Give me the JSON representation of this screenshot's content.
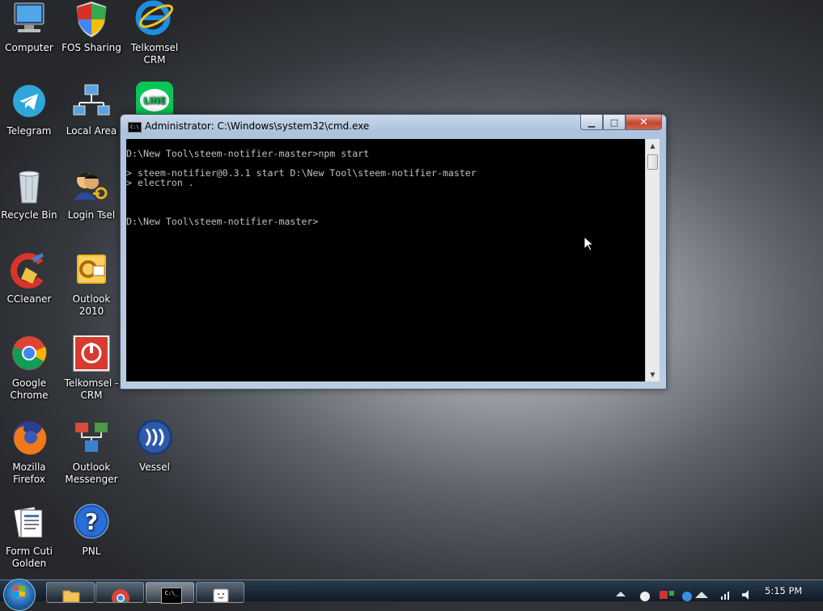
{
  "desktop": {
    "icons": [
      {
        "label": "Computer",
        "icon": "computer-icon"
      },
      {
        "label": "FOS Sharing",
        "icon": "shield-icon"
      },
      {
        "label": "Telkomsel\nCRM",
        "icon": "internet-explorer-icon"
      },
      {
        "label": "Telegram",
        "icon": "telegram-icon"
      },
      {
        "label": "Local Area",
        "icon": "network-icon"
      },
      {
        "label": "",
        "icon": "line-icon",
        "icon_text": "LINE"
      },
      {
        "label": "Recycle Bin",
        "icon": "recycle-bin-icon"
      },
      {
        "label": "Login Tsel",
        "icon": "user-key-icon"
      },
      {
        "label": "CCleaner",
        "icon": "ccleaner-icon"
      },
      {
        "label": "Outlook 2010",
        "icon": "outlook-icon"
      },
      {
        "label": "Google\nChrome",
        "icon": "chrome-icon"
      },
      {
        "label": "Telkomsel -\nCRM",
        "icon": "power-icon"
      },
      {
        "label": "Mozilla\nFirefox",
        "icon": "firefox-icon"
      },
      {
        "label": "Outlook\nMessenger",
        "icon": "messenger-icon"
      },
      {
        "label": "Vessel",
        "icon": "steem-icon"
      },
      {
        "label": "Form Cuti\nGolden",
        "icon": "document-icon"
      },
      {
        "label": "PNL",
        "icon": "help-icon"
      }
    ]
  },
  "cmd_window": {
    "title": "Administrator: C:\\Windows\\system32\\cmd.exe",
    "title_icon_text": "C:\\",
    "minimize": "▁",
    "maximize": "□",
    "close": "✕",
    "lines": [
      "",
      "D:\\New Tool\\steem-notifier-master>npm start",
      "",
      "> steem-notifier@0.3.1 start D:\\New Tool\\steem-notifier-master",
      "> electron .",
      "",
      "",
      "",
      "D:\\New Tool\\steem-notifier-master>"
    ],
    "scroll_up": "▲",
    "scroll_down": "▼"
  },
  "taskbar": {
    "items": [
      {
        "name": "start-button",
        "icon": "windows-logo-icon"
      },
      {
        "name": "explorer",
        "icon": "folder-icon"
      },
      {
        "name": "chrome",
        "icon": "chrome-icon"
      },
      {
        "name": "cmd",
        "icon": "cmd-icon",
        "icon_text": "C:\\_"
      },
      {
        "name": "app",
        "icon": "app-face-icon"
      }
    ],
    "clock": "5:15 PM"
  }
}
